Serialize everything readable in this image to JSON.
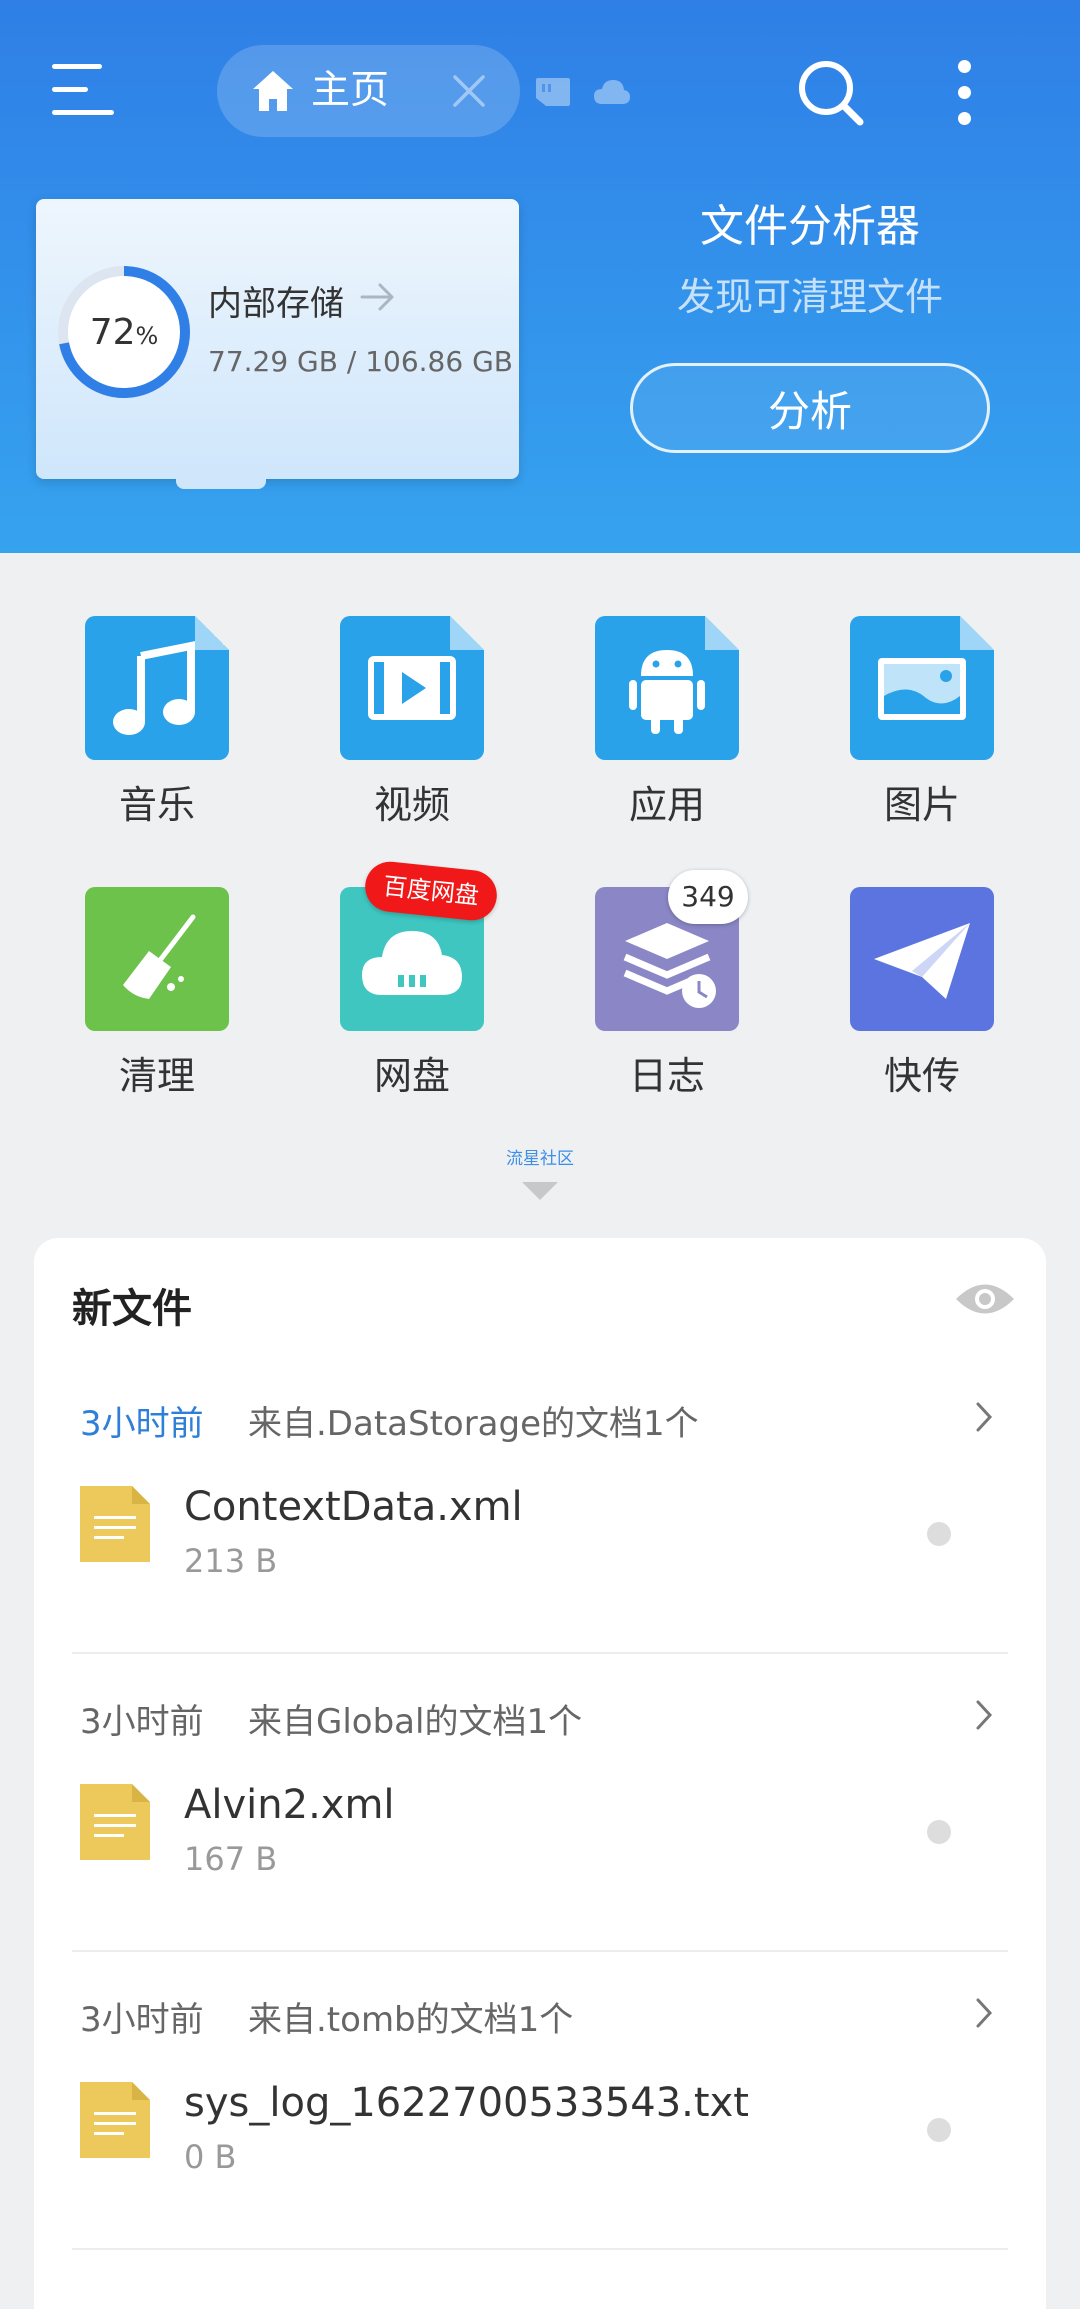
{
  "header": {
    "tab_label": "主页",
    "storage": {
      "title": "内部存储",
      "percent": "72",
      "percent_sign": "%",
      "usage_fraction": 0.72,
      "size_text": "77.29 GB / 106.86 GB"
    },
    "analyzer": {
      "title": "文件分析器",
      "subtitle": "发现可清理文件",
      "button": "分析"
    }
  },
  "categories": [
    {
      "label": "音乐",
      "icon": "music-icon",
      "color": "#2aa2ea"
    },
    {
      "label": "视频",
      "icon": "video-icon",
      "color": "#2aa2ea"
    },
    {
      "label": "应用",
      "icon": "android-icon",
      "color": "#2aa2ea"
    },
    {
      "label": "图片",
      "icon": "image-icon",
      "color": "#2aa2ea"
    },
    {
      "label": "清理",
      "icon": "broom-icon",
      "color": "#6cc24a"
    },
    {
      "label": "网盘",
      "icon": "cloud-drive-icon",
      "color": "#3fc6c0"
    },
    {
      "label": "日志",
      "icon": "log-icon",
      "color": "#8b87c6"
    },
    {
      "label": "快传",
      "icon": "paper-plane-icon",
      "color": "#5b74e0"
    }
  ],
  "badges": {
    "netdisk": "百度网盘",
    "log_count": "349"
  },
  "community_label": "流星社区",
  "new_files": {
    "title": "新文件",
    "groups": [
      {
        "time": "3小时前",
        "source": "来自.DataStorage的文档1个",
        "file_name": "ContextData.xml",
        "file_size": "213 B"
      },
      {
        "time": "3小时前",
        "source": "来自Global的文档1个",
        "file_name": "Alvin2.xml",
        "file_size": "167 B"
      },
      {
        "time": "3小时前",
        "source": "来自.tomb的文档1个",
        "file_name": "sys_log_1622700533543.txt",
        "file_size": "0 B"
      }
    ]
  },
  "colors": {
    "header_top": "#2f7fe6",
    "header_bottom": "#36a3ef",
    "accent": "#2f7fd8",
    "badge_red": "#f01818",
    "file_icon": "#ecc95a"
  }
}
